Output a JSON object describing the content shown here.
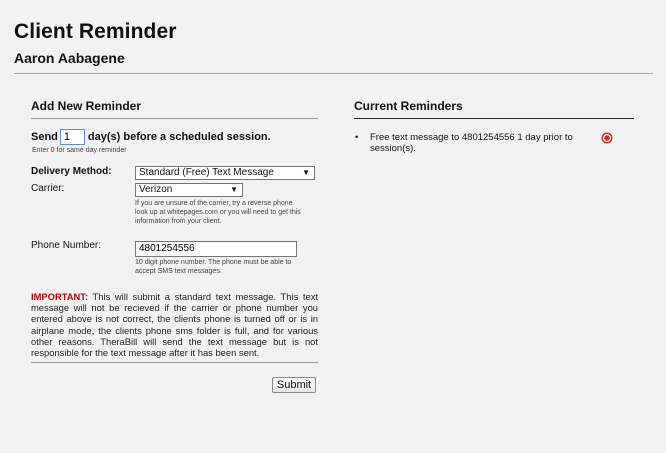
{
  "header": {
    "title": "Client Reminder",
    "client_name": "Aaron Aabagene"
  },
  "add_reminder": {
    "title": "Add New Reminder",
    "send_prefix": "Send",
    "days_value": "1",
    "send_suffix": "day(s) before a scheduled session.",
    "send_hint": "Enter 0 for same day reminder",
    "delivery_label": "Delivery Method:",
    "delivery_value": "Standard (Free) Text Message",
    "carrier_label": "Carrier:",
    "carrier_value": "Verizon",
    "carrier_hint": "If you are unsure of the carrier, try a reverse phone look up at whitepages.com or you will need to get this information from your client.",
    "phone_label": "Phone Number:",
    "phone_value": "4801254556",
    "phone_hint": "10 digit phone number. The phone must be able to accept SMS text messages.",
    "important_label": "IMPORTANT:",
    "important_text": " This will submit a standard text message. This text message will not be recieved if the carrier or phone number you entered above is not correct, the clients phone is turned off or is in airplane mode, the clients phone sms folder is full, and for various other reasons. TheraBill will send the text message but is not responsible for the text message after it has been sent.",
    "submit_label": "Submit"
  },
  "current_reminders": {
    "title": "Current Reminders",
    "items": [
      {
        "text": "Free text message to 4801254556 1 day prior to session(s).",
        "delete_icon": "delete-circle-icon"
      }
    ]
  },
  "colors": {
    "background": "#f2f2f2",
    "important": "#c00000",
    "delete_icon": "#d9281c"
  }
}
